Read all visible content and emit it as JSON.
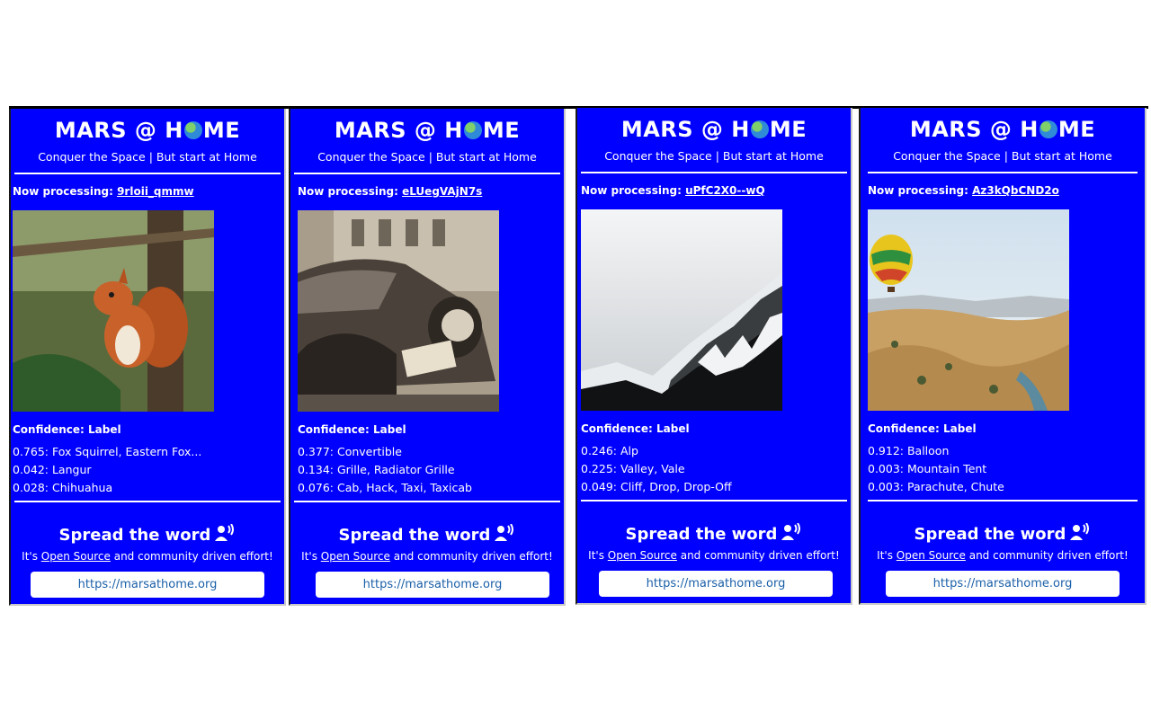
{
  "header": {
    "title_before": "MARS @ H",
    "title_after": "ME",
    "subtitle": "Conquer the Space | But start at Home"
  },
  "labels": {
    "now_processing": "Now processing:",
    "confidence_label": "Confidence: Label",
    "spread_word": "Spread the word",
    "oss_before": "It's",
    "oss_link": "Open Source",
    "oss_after": "and community driven effort!",
    "site_url": "https://marsathome.org"
  },
  "panels": [
    {
      "image_id": "9rloii_qmmw",
      "photo": "squirrel-photo",
      "predictions": [
        "0.765: Fox Squirrel, Eastern Fox...",
        "0.042: Langur",
        "0.028: Chihuahua"
      ]
    },
    {
      "image_id": "eLUegVAjN7s",
      "photo": "vintage-car-photo",
      "predictions": [
        "0.377: Convertible",
        "0.134: Grille, Radiator Grille",
        "0.076: Cab, Hack, Taxi, Taxicab"
      ]
    },
    {
      "image_id": "uPfC2X0--wQ",
      "photo": "snowy-mountain-photo",
      "predictions": [
        "0.246: Alp",
        "0.225: Valley, Vale",
        "0.049: Cliff, Drop, Drop-Off"
      ]
    },
    {
      "image_id": "Az3kQbCND2o",
      "photo": "hot-air-balloon-photo",
      "predictions": [
        "0.912: Balloon",
        "0.003: Mountain Tent",
        "0.003: Parachute, Chute"
      ]
    }
  ],
  "colors": {
    "panel_bg": "#0000ff",
    "text": "#ffffff",
    "link_button_text": "#1a5fa8"
  }
}
